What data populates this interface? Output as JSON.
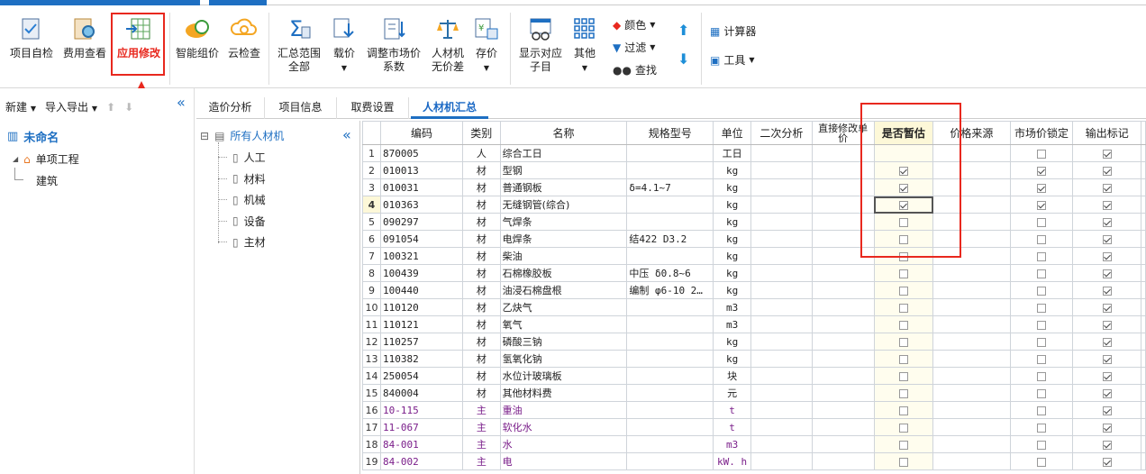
{
  "ribbon": {
    "buttons": [
      {
        "label": "项目自检"
      },
      {
        "label": "费用查看"
      },
      {
        "label": "应用修改"
      },
      {
        "label": "智能组价"
      },
      {
        "label": "云检查"
      },
      {
        "label": "汇总范围",
        "label2": "全部"
      },
      {
        "label": "载价"
      },
      {
        "label": "调整市场价",
        "label2": "系数"
      },
      {
        "label": "人材机",
        "label2": "无价差"
      },
      {
        "label": "存价"
      },
      {
        "label": "显示对应",
        "label2": "子目"
      },
      {
        "label": "其他"
      }
    ],
    "small": {
      "color": "颜色",
      "filter": "过滤",
      "find": "查找",
      "calculator": "计算器",
      "tools": "工具"
    }
  },
  "left": {
    "new": "新建",
    "import_export": "导入导出",
    "project_name": "未命名",
    "unit_project": "单项工程",
    "building": "建筑"
  },
  "tabs": [
    "造价分析",
    "项目信息",
    "取费设置",
    "人材机汇总"
  ],
  "tree": {
    "root": "所有人材机",
    "items": [
      "人工",
      "材料",
      "机械",
      "设备",
      "主材"
    ]
  },
  "grid": {
    "headers": [
      "编码",
      "类别",
      "名称",
      "规格型号",
      "单位",
      "二次分析",
      "直接修改单价",
      "是否暂估",
      "价格来源",
      "市场价锁定",
      "输出标记"
    ],
    "rows": [
      {
        "no": "1",
        "code": "870005",
        "type": "人",
        "name": "综合工日",
        "spec": "",
        "unit": "工日",
        "est": null,
        "lock": false,
        "out": true,
        "main": false
      },
      {
        "no": "2",
        "code": "010013",
        "type": "材",
        "name": "型钢",
        "spec": "",
        "unit": "kg",
        "est": true,
        "lock": true,
        "out": true,
        "main": false
      },
      {
        "no": "3",
        "code": "010031",
        "type": "材",
        "name": "普通钢板",
        "spec": "δ=4.1~7",
        "unit": "kg",
        "est": true,
        "lock": true,
        "out": true,
        "main": false
      },
      {
        "no": "4",
        "code": "010363",
        "type": "材",
        "name": "无缝钢管(综合)",
        "spec": "",
        "unit": "kg",
        "est": true,
        "lock": true,
        "out": true,
        "main": false
      },
      {
        "no": "5",
        "code": "090297",
        "type": "材",
        "name": "气焊条",
        "spec": "",
        "unit": "kg",
        "est": false,
        "lock": false,
        "out": true,
        "main": false
      },
      {
        "no": "6",
        "code": "091054",
        "type": "材",
        "name": "电焊条",
        "spec": "结422 D3.2",
        "unit": "kg",
        "est": false,
        "lock": false,
        "out": true,
        "main": false
      },
      {
        "no": "7",
        "code": "100321",
        "type": "材",
        "name": "柴油",
        "spec": "",
        "unit": "kg",
        "est": false,
        "lock": false,
        "out": true,
        "main": false
      },
      {
        "no": "8",
        "code": "100439",
        "type": "材",
        "name": "石棉橡胶板",
        "spec": "中压 δ0.8~6",
        "unit": "kg",
        "est": false,
        "lock": false,
        "out": true,
        "main": false
      },
      {
        "no": "9",
        "code": "100440",
        "type": "材",
        "name": "油浸石棉盘根",
        "spec": "编制 φ6-10 2…",
        "unit": "kg",
        "est": false,
        "lock": false,
        "out": true,
        "main": false
      },
      {
        "no": "10",
        "code": "110120",
        "type": "材",
        "name": "乙炔气",
        "spec": "",
        "unit": "m3",
        "est": false,
        "lock": false,
        "out": true,
        "main": false
      },
      {
        "no": "11",
        "code": "110121",
        "type": "材",
        "name": "氧气",
        "spec": "",
        "unit": "m3",
        "est": false,
        "lock": false,
        "out": true,
        "main": false
      },
      {
        "no": "12",
        "code": "110257",
        "type": "材",
        "name": "磷酸三钠",
        "spec": "",
        "unit": "kg",
        "est": false,
        "lock": false,
        "out": true,
        "main": false
      },
      {
        "no": "13",
        "code": "110382",
        "type": "材",
        "name": "氢氧化钠",
        "spec": "",
        "unit": "kg",
        "est": false,
        "lock": false,
        "out": true,
        "main": false
      },
      {
        "no": "14",
        "code": "250054",
        "type": "材",
        "name": "水位计玻璃板",
        "spec": "",
        "unit": "块",
        "est": false,
        "lock": false,
        "out": true,
        "main": false
      },
      {
        "no": "15",
        "code": "840004",
        "type": "材",
        "name": "其他材料费",
        "spec": "",
        "unit": "元",
        "est": false,
        "lock": false,
        "out": true,
        "main": false
      },
      {
        "no": "16",
        "code": "10-115",
        "type": "主",
        "name": "重油",
        "spec": "",
        "unit": "t",
        "est": false,
        "lock": false,
        "out": true,
        "main": true
      },
      {
        "no": "17",
        "code": "11-067",
        "type": "主",
        "name": "软化水",
        "spec": "",
        "unit": "t",
        "est": false,
        "lock": false,
        "out": true,
        "main": true
      },
      {
        "no": "18",
        "code": "84-001",
        "type": "主",
        "name": "水",
        "spec": "",
        "unit": "m3",
        "est": false,
        "lock": false,
        "out": true,
        "main": true
      },
      {
        "no": "19",
        "code": "84-002",
        "type": "主",
        "name": "电",
        "spec": "",
        "unit": "kW. h",
        "est": false,
        "lock": false,
        "out": true,
        "main": true
      }
    ]
  },
  "colors": {
    "accent": "#1e6fc2",
    "highlight_border": "#e8281e",
    "main_text": "#7a1e8a"
  }
}
